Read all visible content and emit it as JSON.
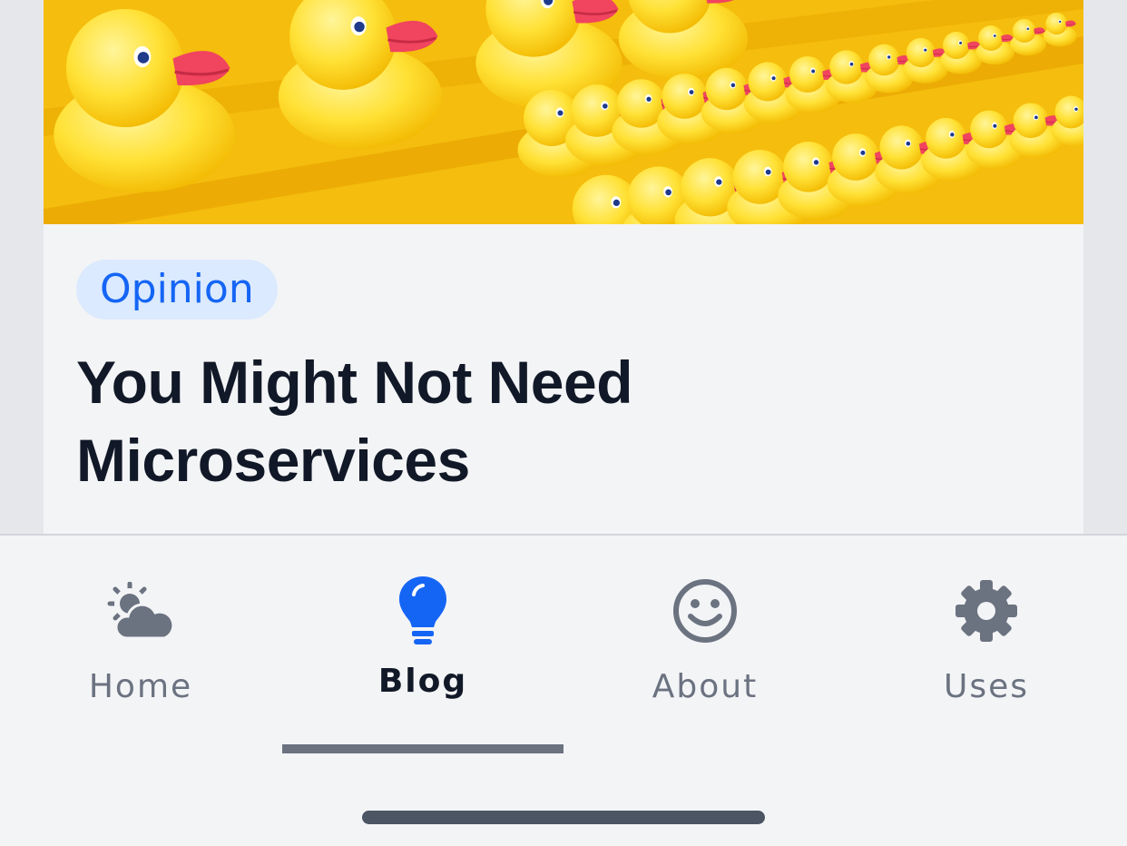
{
  "article": {
    "category": "Opinion",
    "title": "You Might Not Need Microservices",
    "image_alt": "rows of yellow rubber ducks"
  },
  "colors": {
    "accent": "#1565f5",
    "badge_bg": "#dbeafe",
    "text_dark": "#111827",
    "text_muted": "#6b7280"
  },
  "tabbar": {
    "items": [
      {
        "label": "Home",
        "icon": "sun-cloud-icon",
        "active": false
      },
      {
        "label": "Blog",
        "icon": "lightbulb-icon",
        "active": true
      },
      {
        "label": "About",
        "icon": "smiley-icon",
        "active": false
      },
      {
        "label": "Uses",
        "icon": "gear-icon",
        "active": false
      }
    ]
  }
}
